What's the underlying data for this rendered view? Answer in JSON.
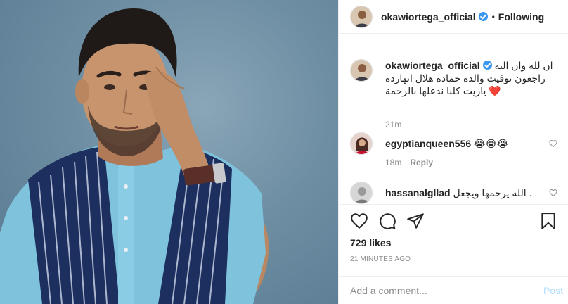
{
  "header": {
    "username": "okawiortega_official",
    "separator": "•",
    "follow_status": "Following"
  },
  "caption": {
    "username": "okawiortega_official",
    "text_line1": "ان لله وان اليه",
    "text_line2": "راجعون توفيت والدة حماده هلال انهاردة",
    "text_line3": "ياريت كلنا ندعلها بالرحمة ❤️",
    "time": "21m"
  },
  "comments": [
    {
      "username": "egyptianqueen556",
      "text": "😭😭😭",
      "time": "18m",
      "reply": "Reply"
    },
    {
      "username": "hassanalgllad",
      "text": "الله يرحمها ويجعل ."
    }
  ],
  "actions": {
    "likes": "729 likes",
    "posted_time": "21 MINUTES AGO"
  },
  "add_comment": {
    "placeholder": "Add a comment...",
    "post_label": "Post"
  },
  "colors": {
    "verified": "#3897f0",
    "muted": "#8e8e8e",
    "post_disabled": "#b2dffc",
    "heart": "#ed4956"
  },
  "icons": [
    "heart-icon",
    "comment-icon",
    "share-icon",
    "bookmark-icon",
    "verified-icon",
    "small-heart-icon"
  ]
}
